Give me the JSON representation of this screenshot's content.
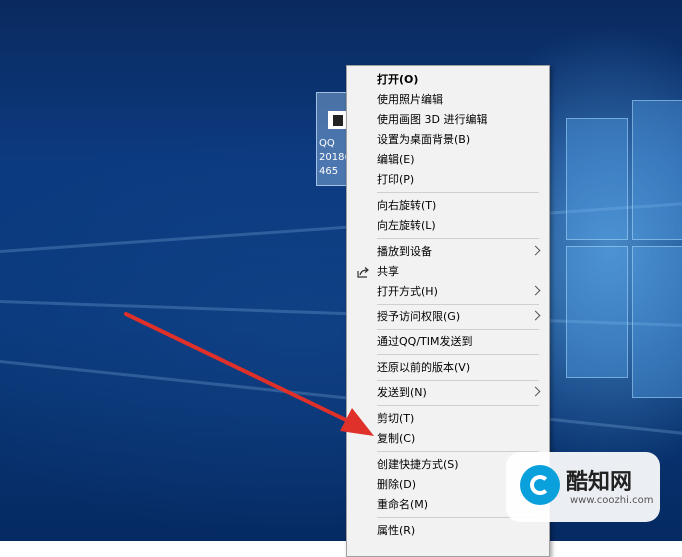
{
  "desktop_icon": {
    "name": "QQ\n2018(\n465"
  },
  "context_menu": {
    "open": "打开(O)",
    "edit_with_photos": "使用照片编辑",
    "edit_with_paint3d": "使用画图 3D 进行编辑",
    "set_as_background": "设置为桌面背景(B)",
    "edit": "编辑(E)",
    "print": "打印(P)",
    "rotate_right": "向右旋转(T)",
    "rotate_left": "向左旋转(L)",
    "cast_to_device": "播放到设备",
    "share": "共享",
    "open_with": "打开方式(H)",
    "give_access": "授予访问权限(G)",
    "send_via_qq": "通过QQ/TIM发送到",
    "restore_versions": "还原以前的版本(V)",
    "send_to": "发送到(N)",
    "cut": "剪切(T)",
    "copy": "复制(C)",
    "create_shortcut": "创建快捷方式(S)",
    "delete": "删除(D)",
    "rename": "重命名(M)",
    "properties": "属性(R)"
  },
  "watermark": {
    "title": "酷知网",
    "url": "www.coozhi.com"
  },
  "colors": {
    "arrow": "#e0302a",
    "menu_bg": "#f2f2f2",
    "desktop": "#0c3a80"
  }
}
